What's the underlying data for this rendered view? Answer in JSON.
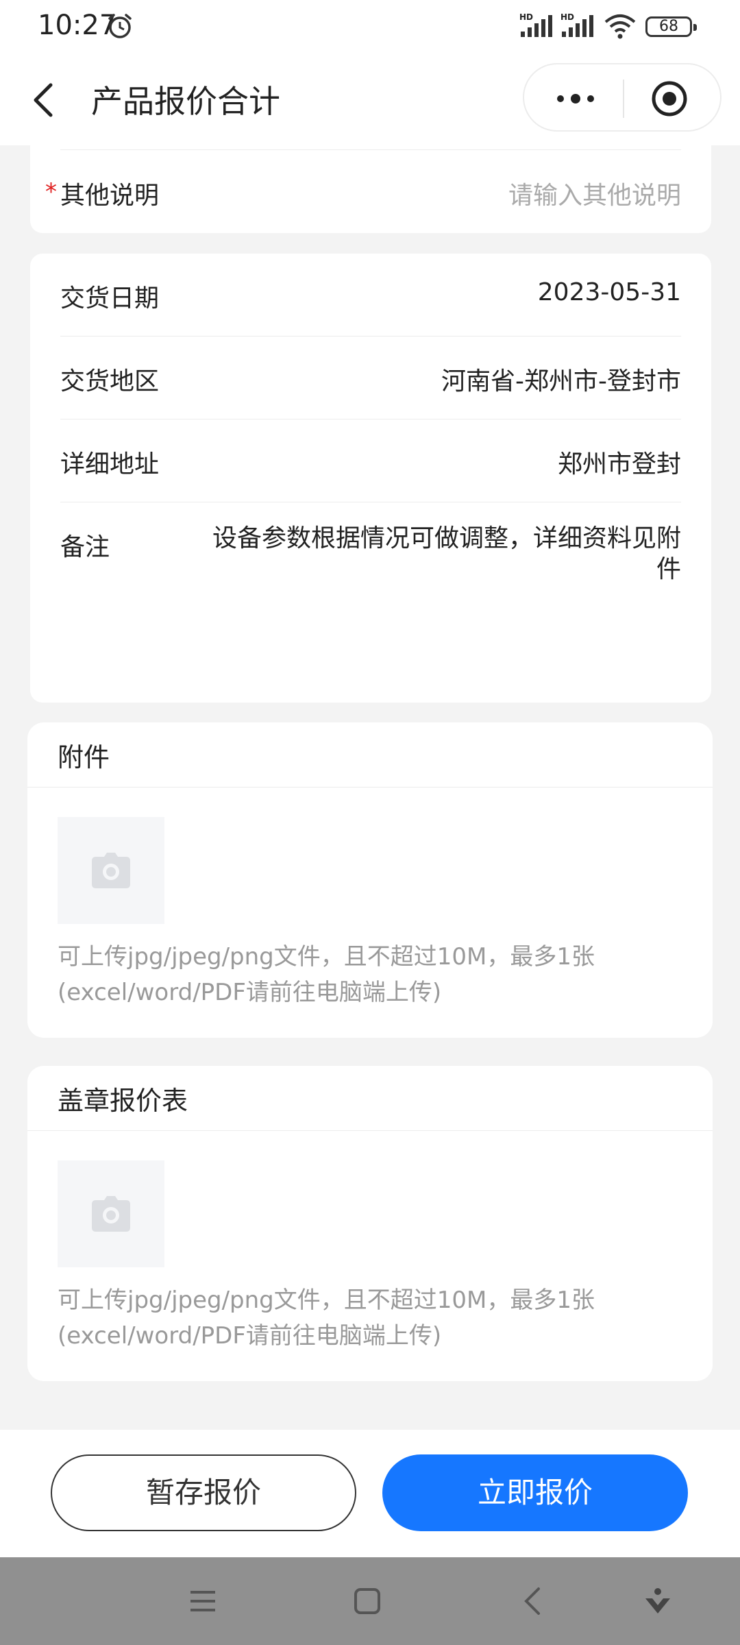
{
  "status_bar": {
    "time": "10:27",
    "battery": "68",
    "signal1_label": "HD",
    "signal2_label": "HD"
  },
  "nav": {
    "title": "产品报价合计"
  },
  "other_notes": {
    "required_mark": "*",
    "label": "其他说明",
    "placeholder": "请输入其他说明"
  },
  "delivery": {
    "date_label": "交货日期",
    "date_value": "2023-05-31",
    "region_label": "交货地区",
    "region_value": "河南省-郑州市-登封市",
    "address_label": "详细地址",
    "address_value": "郑州市登封",
    "remark_label": "备注",
    "remark_value": "设备参数根据情况可做调整，详细资料见附件"
  },
  "attachment": {
    "title": "附件",
    "hint_line1": "可上传jpg/jpeg/png文件，且不超过10M，最多1张",
    "hint_line2": "(excel/word/PDF请前往电脑端上传)"
  },
  "stamped_quote": {
    "title": "盖章报价表",
    "hint_line1": "可上传jpg/jpeg/png文件，且不超过10M，最多1张",
    "hint_line2": "(excel/word/PDF请前往电脑端上传)"
  },
  "actions": {
    "save_label": "暂存报价",
    "submit_label": "立即报价",
    "submit_color": "#1677ff"
  },
  "icons": {
    "upload": "camera-icon",
    "back": "chevron-left-icon",
    "more": "more-dots-icon",
    "close": "target-circle-icon"
  }
}
